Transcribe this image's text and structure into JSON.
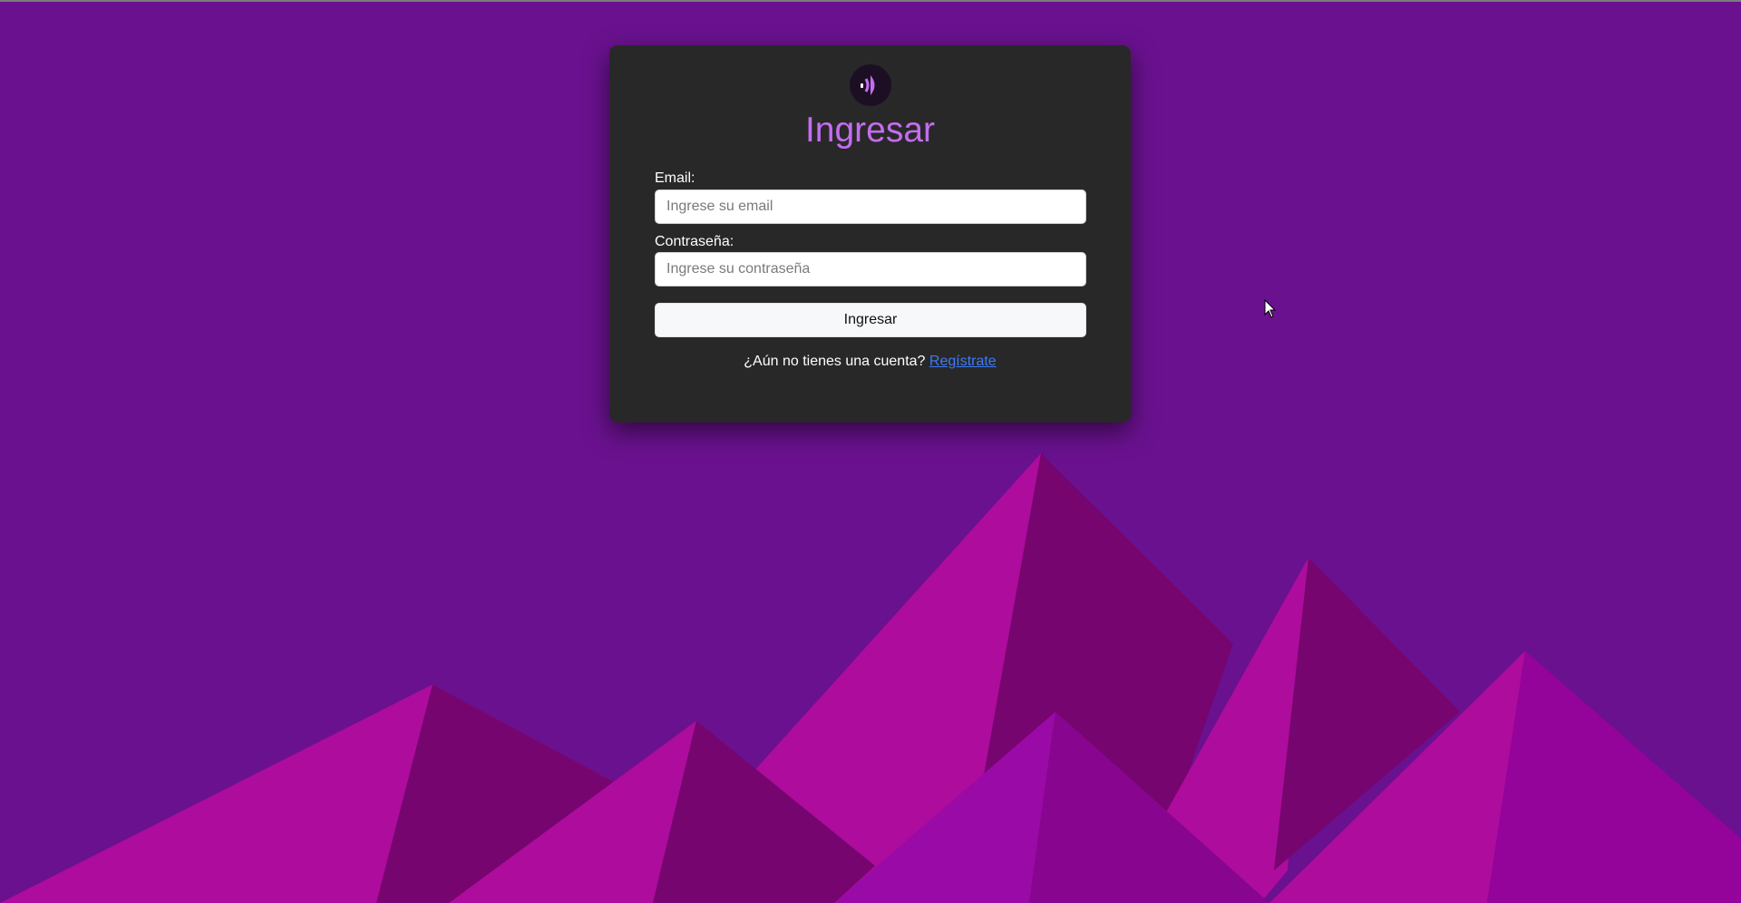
{
  "colors": {
    "background": "#6a118f",
    "card": "#282828",
    "title": "#c56cf0",
    "link": "#3d7bf7",
    "mountain_light": "#ad0c9c",
    "mountain_dark": "#76056f",
    "mountain_mid": "#9a0aa6"
  },
  "icons": {
    "logo": "sound-wave-logo-icon",
    "cursor": "mouse-pointer-icon"
  },
  "login": {
    "title": "Ingresar",
    "email_label": "Email:",
    "email_placeholder": "Ingrese su email",
    "email_value": "",
    "password_label": "Contraseña:",
    "password_placeholder": "Ingrese su contraseña",
    "password_value": "",
    "submit_label": "Ingresar",
    "register_prompt": "¿Aún no tienes una cuenta?",
    "register_link": "Regístrate"
  }
}
